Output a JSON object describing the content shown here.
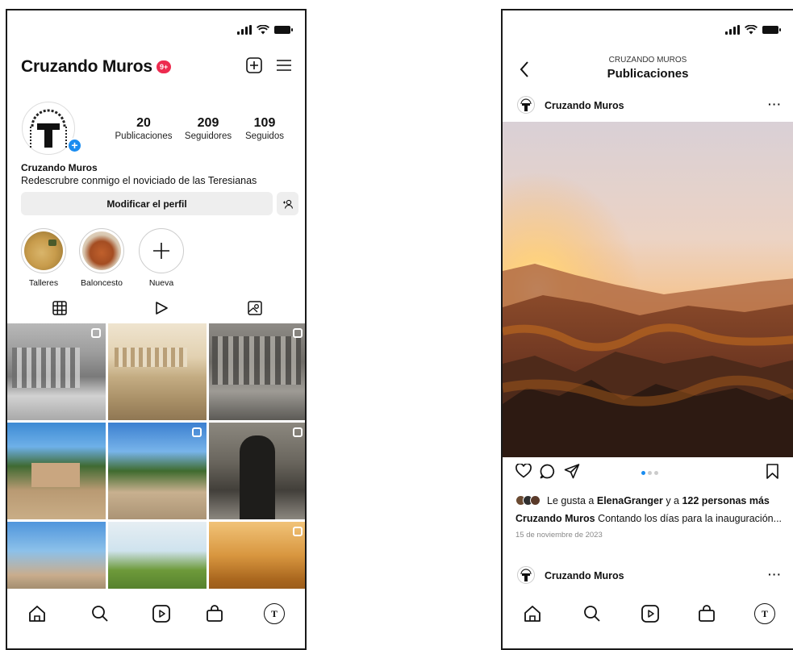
{
  "left": {
    "profile_name": "Cruzando Muros",
    "notif_badge": "9+",
    "stats": [
      {
        "count": "20",
        "label": "Publicaciones"
      },
      {
        "count": "209",
        "label": "Seguidores"
      },
      {
        "count": "109",
        "label": "Seguidos"
      }
    ],
    "bio_name": "Cruzando Muros",
    "bio_text": "Redescrubre conmigo el noviciado de las Teresianas",
    "edit_profile": "Modificar el perfil",
    "highlights": [
      {
        "label": "Talleres"
      },
      {
        "label": "Baloncesto"
      },
      {
        "label": "Nueva"
      }
    ],
    "avatar_letter": "T"
  },
  "right": {
    "header_sub": "CRUZANDO MUROS",
    "header_title": "Publicaciones",
    "post_user": "Cruzando Muros",
    "likes_prefix": "Le gusta a ",
    "likes_user": "ElenaGranger",
    "likes_mid": " y a ",
    "likes_count": "122 personas más",
    "caption_user": "Cruzando Muros",
    "caption_text": " Contando los días para la inauguración...",
    "date": "15 de noviembre de 2023",
    "next_post_user": "Cruzando Muros",
    "more_label": "···",
    "avatar_letter": "T"
  },
  "icons": {
    "nav": [
      "home-icon",
      "search-icon",
      "reels-icon",
      "shop-icon",
      "profile-icon"
    ]
  },
  "colors": {
    "accent_blue": "#1a8cf0",
    "badge_red": "#ed2b4f"
  }
}
